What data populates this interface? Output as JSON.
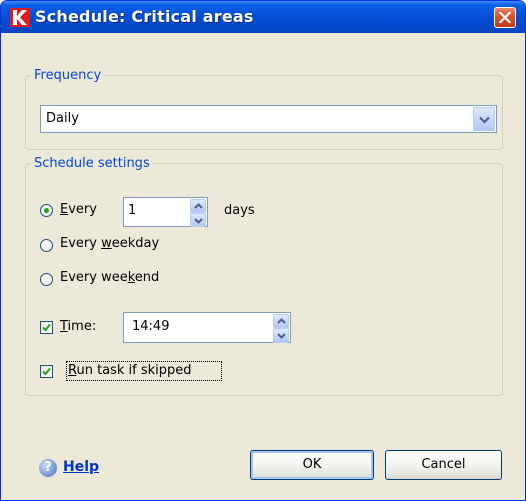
{
  "window": {
    "title": "Schedule: Critical areas",
    "icon": "kaspersky-k-icon",
    "close_icon": "close-icon"
  },
  "frequency": {
    "legend": "Frequency",
    "selected": "Daily",
    "arrow_icon": "chevron-down-icon"
  },
  "schedule": {
    "legend": "Schedule settings",
    "every": {
      "label_underlined": "E",
      "label_rest": "very",
      "value": "1",
      "unit": "days",
      "checked": true
    },
    "weekday": {
      "label_before": "Every ",
      "label_underlined": "w",
      "label_after": "eekday",
      "checked": false
    },
    "weekend": {
      "label_before": "Every wee",
      "label_underlined": "k",
      "label_after": "end",
      "checked": false
    },
    "time": {
      "label_underlined": "T",
      "label_rest": "ime:",
      "value": "14:49",
      "checked": true
    },
    "run_skipped": {
      "label_underlined": "R",
      "label_rest": "un task if skipped",
      "checked": true
    }
  },
  "footer": {
    "help_label": "Help",
    "help_icon": "help-question-icon",
    "ok_label": "OK",
    "cancel_label": "Cancel"
  },
  "colors": {
    "titlebar": "#0550d8",
    "legend": "#0046d5",
    "dialog_bg": "#ece9d8",
    "link": "#0033cc"
  }
}
